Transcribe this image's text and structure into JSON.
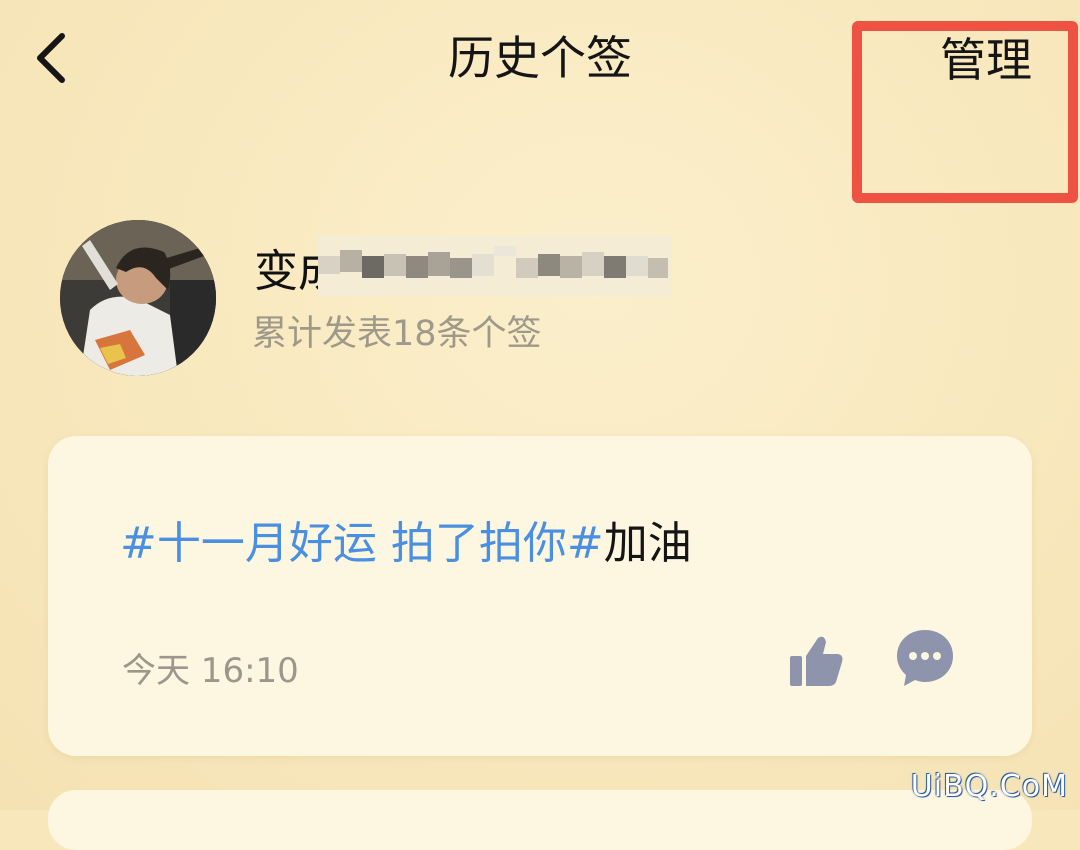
{
  "header": {
    "title": "历史个签",
    "back_icon": "chevron-left-icon",
    "manage_label": "管理",
    "highlight_color": "#ee5243"
  },
  "profile": {
    "name_visible": "变成",
    "post_count": "累计发表18条个签"
  },
  "posts": [
    {
      "tag_text": "#十一月好运 拍了拍你#",
      "body_text": "加油",
      "time": "今天 16:10",
      "like_icon": "thumbs-up-icon",
      "comment_icon": "comment-bubble-icon"
    }
  ],
  "colors": {
    "background": "#f8e7bb",
    "card": "#fdf7e2",
    "tag": "#4a8fe0",
    "icon": "#8e94ab"
  },
  "watermark": "UiBQ.CoM"
}
